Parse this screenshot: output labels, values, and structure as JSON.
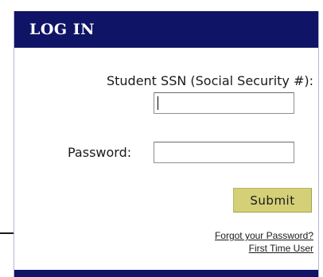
{
  "login": {
    "title": "LOG IN",
    "ssn_label": "Student SSN (Social Security #):",
    "ssn_value": "",
    "password_label": "Password:",
    "password_value": "",
    "submit_label": "Submit",
    "forgot_password_link": "Forgot your Password?",
    "first_time_user_link": "First Time User"
  },
  "colors": {
    "header_background": "#0f1466",
    "header_text": "#ffffff",
    "submit_background": "#d4d077",
    "panel_border": "#b3b9d0"
  }
}
